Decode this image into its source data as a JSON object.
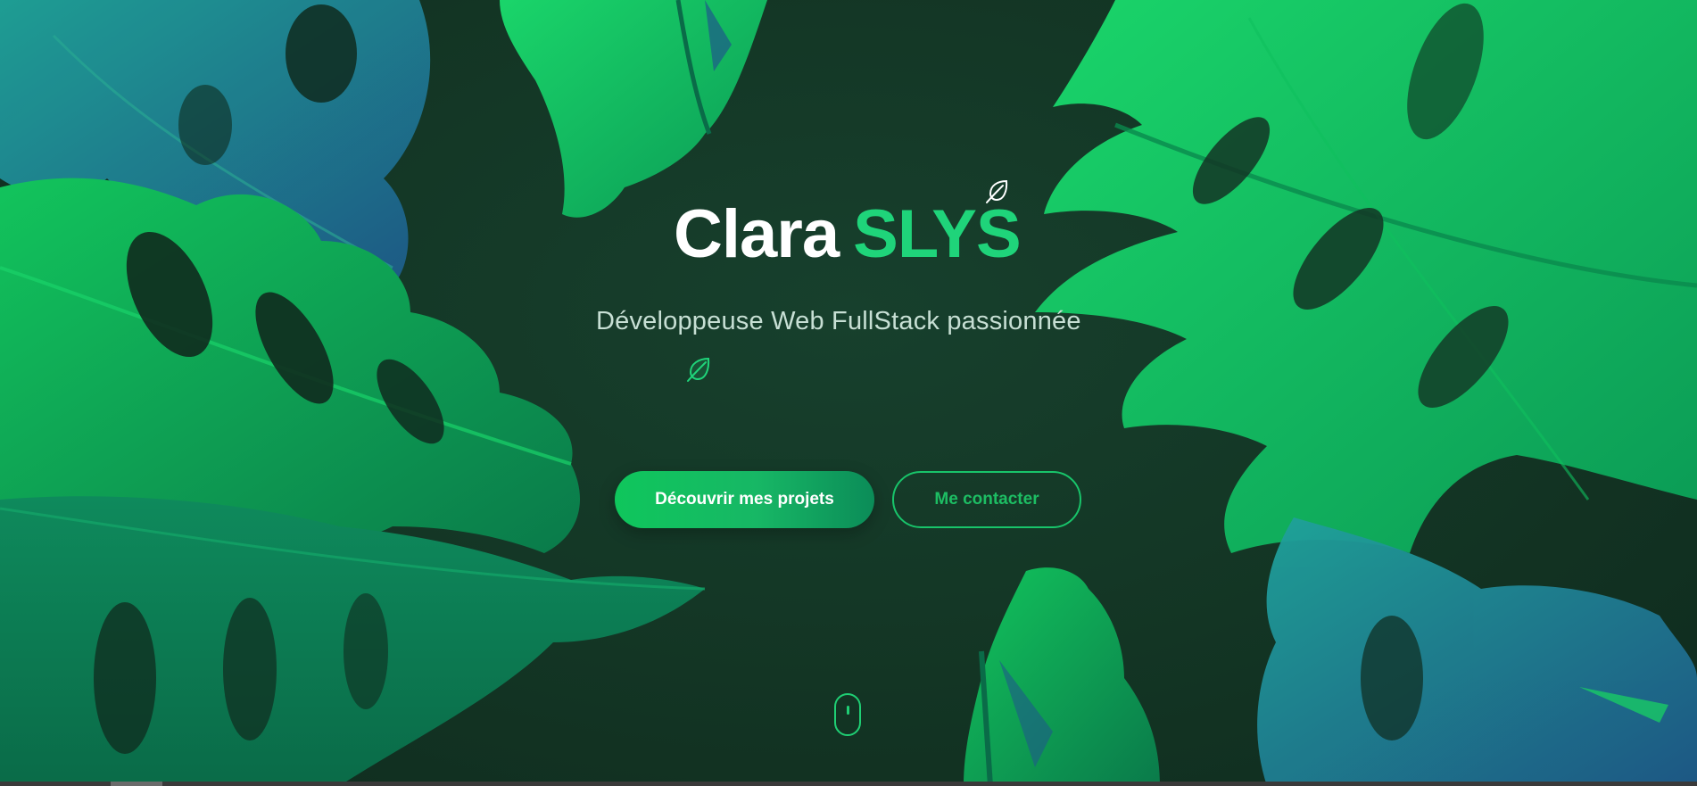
{
  "hero": {
    "name_first": "Clara",
    "name_last": "SLYS",
    "subtitle": "Développeuse Web FullStack passionnée",
    "primary_button": "Découvrir mes projets",
    "secondary_button": "Me contacter"
  },
  "icons": {
    "title_decoration": "leaf-icon",
    "cursor": "leaf-cursor-icon",
    "scroll": "mouse-scroll-icon"
  },
  "colors": {
    "background": "#153a2a",
    "accent": "#1fd47a",
    "primary_button": "#0fc65c",
    "text_light": "#c7dfd4"
  }
}
